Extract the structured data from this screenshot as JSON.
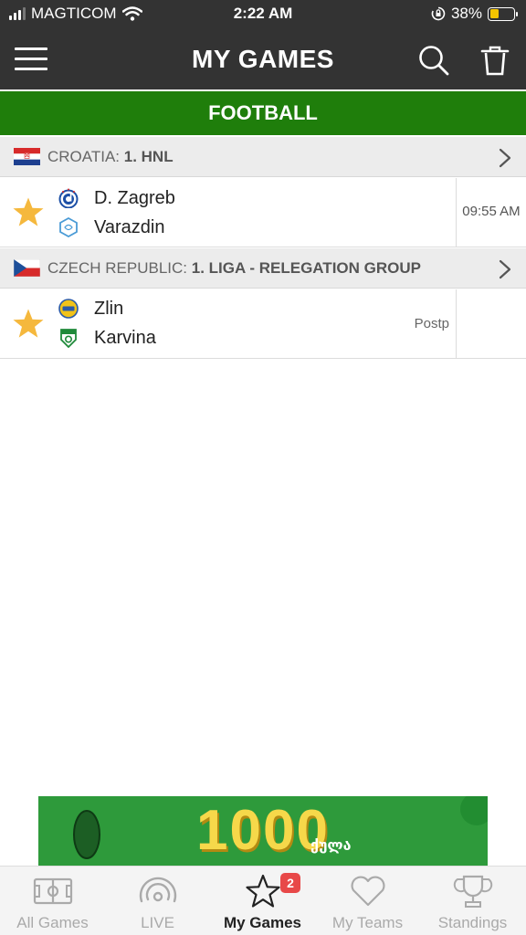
{
  "status_bar": {
    "carrier": "MAGTICOM",
    "time": "2:22 AM",
    "battery_percent": "38%",
    "battery_level": 0.38
  },
  "header": {
    "title": "MY GAMES",
    "menu_icon": "hamburger-menu-icon",
    "search_icon": "search-icon",
    "delete_icon": "trash-icon"
  },
  "sport": {
    "label": "FOOTBALL",
    "color": "#1f7e0b"
  },
  "leagues": [
    {
      "country": "CROATIA: ",
      "name": "1. HNL",
      "flag": "croatia-flag-icon",
      "matches": [
        {
          "home": "D. Zagreb",
          "away": "Varazdin",
          "time": "09:55 AM",
          "status": "",
          "favorite": true
        }
      ]
    },
    {
      "country": "CZECH REPUBLIC: ",
      "name": "1. LIGA - RELEGATION GROUP",
      "flag": "czech-flag-icon",
      "matches": [
        {
          "home": "Zlin",
          "away": "Karvina",
          "time": "",
          "status": "Postp",
          "favorite": true
        }
      ]
    }
  ],
  "ad": {
    "amount": "1000",
    "subtitle": "ქულა"
  },
  "tabs": [
    {
      "label": "All Games",
      "icon": "field-icon",
      "active": false
    },
    {
      "label": "LIVE",
      "icon": "live-broadcast-icon",
      "active": false
    },
    {
      "label": "My Games",
      "icon": "star-icon",
      "active": true,
      "badge": "2"
    },
    {
      "label": "My Teams",
      "icon": "heart-icon",
      "active": false
    },
    {
      "label": "Standings",
      "icon": "trophy-icon",
      "active": false
    }
  ],
  "colors": {
    "header_bg": "#333333",
    "favorite_star": "#f5b83d",
    "badge": "#e84848",
    "battery": "#f5c400"
  }
}
